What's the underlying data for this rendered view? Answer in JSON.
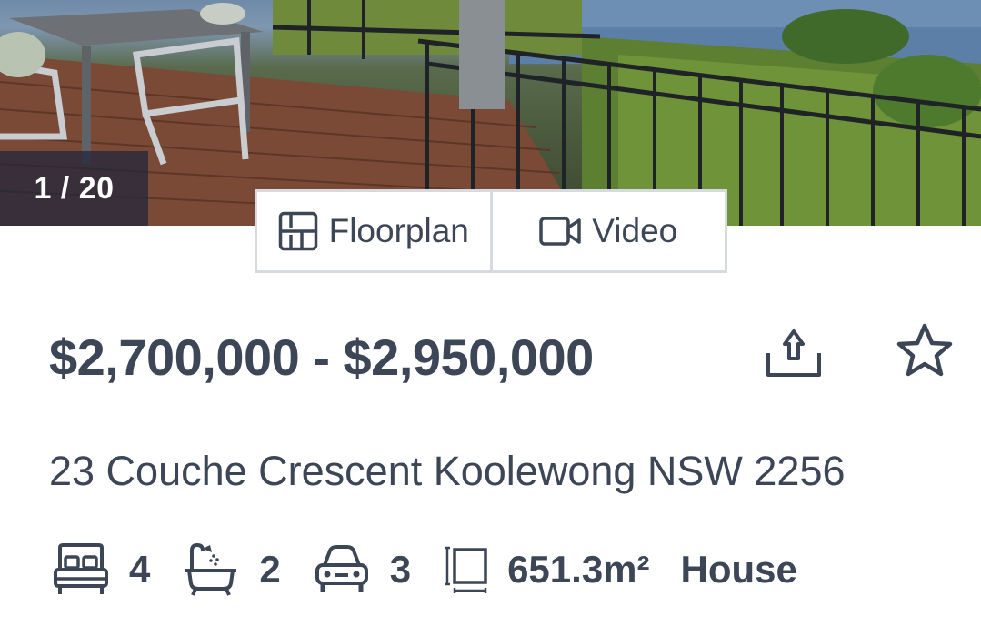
{
  "gallery": {
    "counter": "1 / 20",
    "image_description": "Deck with outdoor table and chairs overlooking water"
  },
  "media": {
    "floorplan_label": "Floorplan",
    "video_label": "Video",
    "floorplan_icon": "floorplan-icon",
    "video_icon": "video-camera-icon"
  },
  "listing": {
    "price": "$2,700,000 - $2,950,000",
    "address": "23 Couche Crescent Koolewong NSW 2256",
    "bedrooms": "4",
    "bathrooms": "2",
    "parking": "3",
    "land_size": "651.3m²",
    "property_type": "House"
  },
  "actions": {
    "share_icon": "share-icon",
    "favourite_icon": "star-icon"
  },
  "colors": {
    "text": "#3d4656",
    "border": "#d6d9de",
    "counter_bg": "#1e263c"
  }
}
